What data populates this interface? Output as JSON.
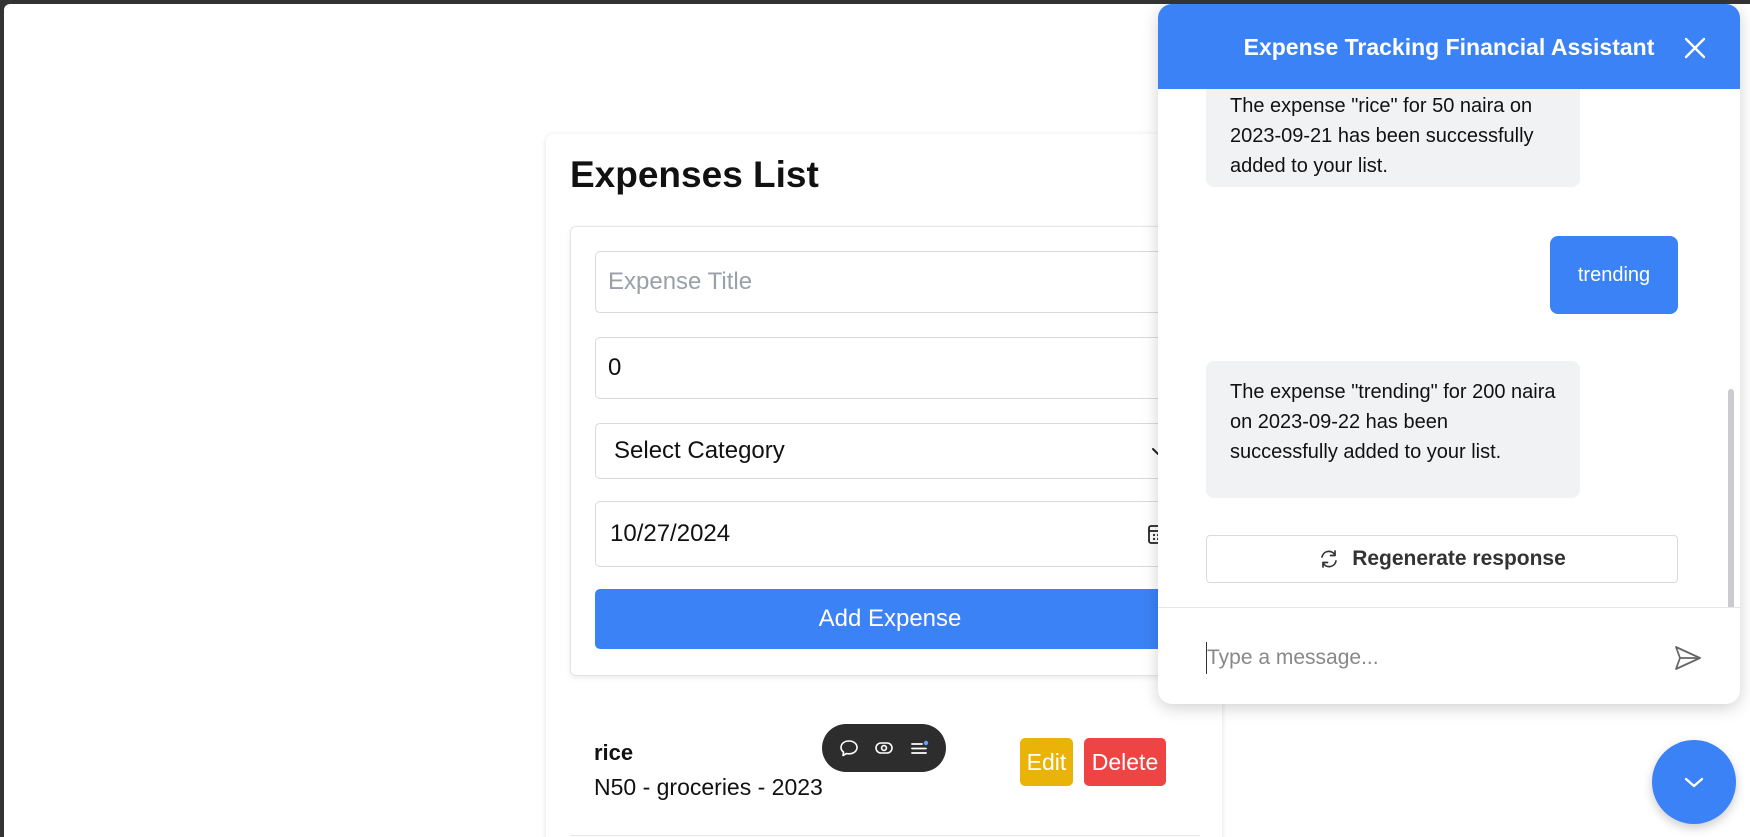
{
  "expenses_card": {
    "title": "Expenses List",
    "form": {
      "title_placeholder": "Expense Title",
      "amount_value": "0",
      "category_selected": "Select Category",
      "date_value": "10/27/2024",
      "add_button_label": "Add Expense"
    },
    "items": [
      {
        "title": "rice",
        "subtitle": "N50 - groceries - 2023",
        "edit_label": "Edit",
        "delete_label": "Delete"
      }
    ]
  },
  "chat": {
    "title": "Expense Tracking Financial Assistant",
    "messages": [
      {
        "role": "assistant",
        "text": "The expense \"rice\" for 50 naira on 2023-09-21 has been successfully added to your list."
      },
      {
        "role": "user",
        "text": "trending"
      },
      {
        "role": "assistant",
        "text": "The expense \"trending\" for 200 naira on 2023-09-22 has been successfully added to your list."
      }
    ],
    "regenerate_label": "Regenerate response",
    "input_placeholder": "Type a message..."
  },
  "colors": {
    "accent": "#3b82f6",
    "edit": "#eab308",
    "delete": "#ef4444",
    "bubble_ai": "#f1f2f4"
  },
  "icons": {
    "close": "close-icon",
    "calendar": "calendar-icon",
    "chevron": "chevron-down-icon",
    "send": "send-icon",
    "refresh": "refresh-icon",
    "fab": "chevron-down-icon",
    "toolbar": [
      "comment-icon",
      "eye-icon",
      "list-icon"
    ]
  }
}
